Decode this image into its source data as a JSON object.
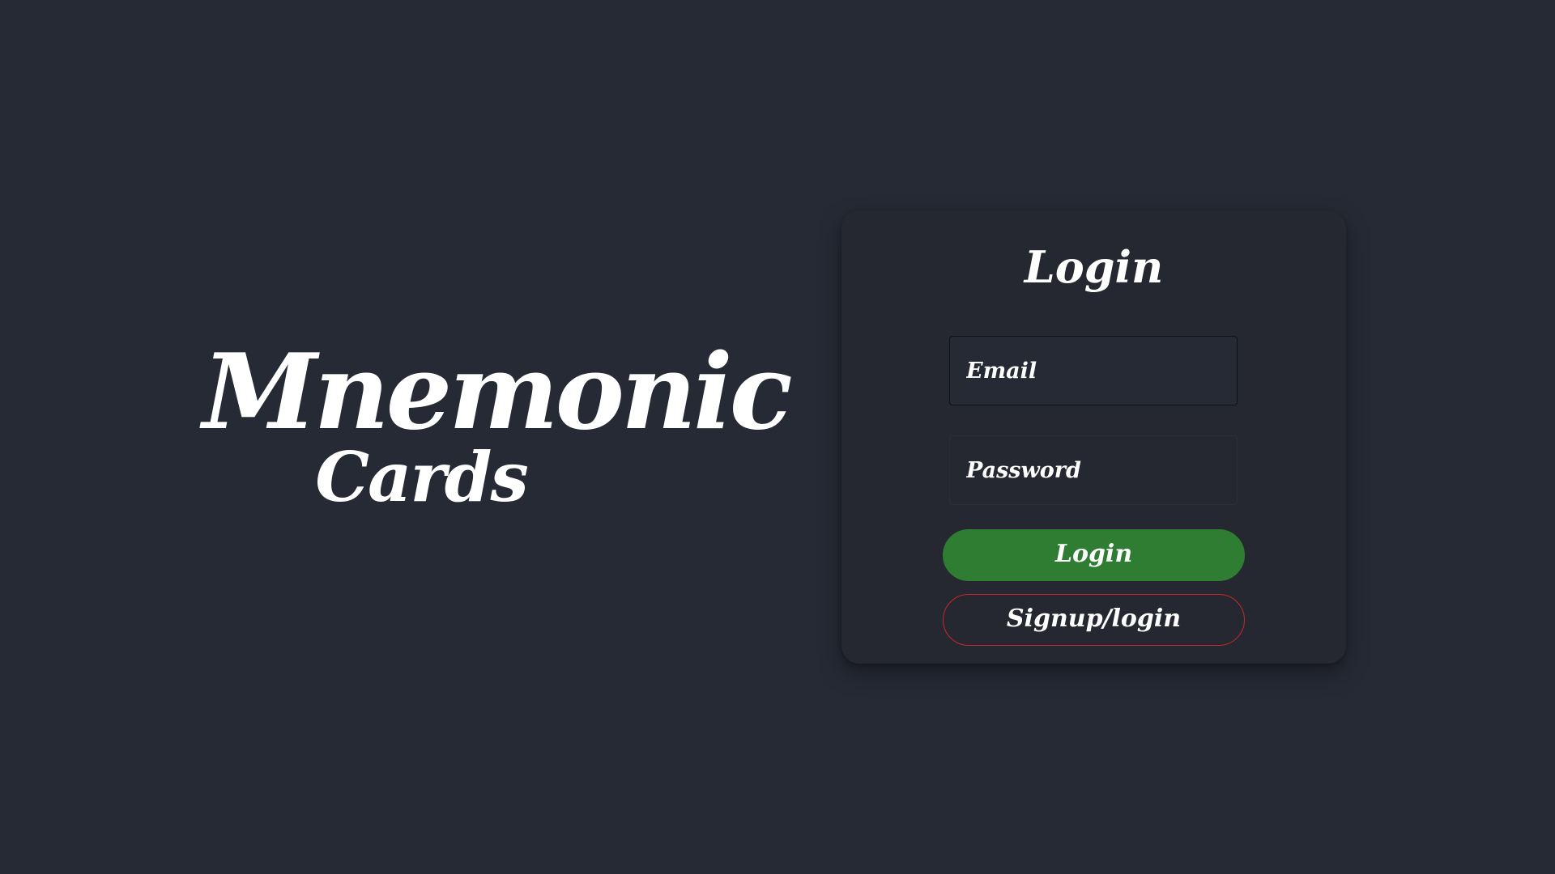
{
  "brand": {
    "title": "Mnemonic",
    "subtitle": "Cards"
  },
  "login_card": {
    "title": "Login",
    "email_placeholder": "Email",
    "password_placeholder": "Password",
    "login_button_label": "Login",
    "signup_button_label": "Signup/login"
  },
  "colors": {
    "background": "#262a35",
    "card": "#252830",
    "login_button": "#2e7d32",
    "signup_border": "#c62828",
    "text": "#ffffff"
  }
}
